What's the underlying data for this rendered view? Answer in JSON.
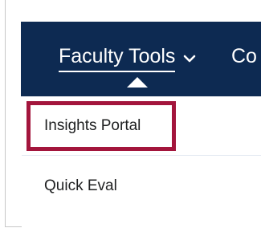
{
  "nav": {
    "faculty_tools_label": "Faculty Tools",
    "next_item_partial": "Co"
  },
  "dropdown": {
    "items": [
      {
        "label": "Insights Portal",
        "highlighted": true
      },
      {
        "label": "Quick Eval",
        "highlighted": false
      }
    ]
  },
  "colors": {
    "navbar_bg": "#0d2a52",
    "highlight_border": "#a3153c",
    "menu_text": "#202122"
  },
  "icons": {
    "dropdown_chevron": "chevron-down-icon"
  }
}
